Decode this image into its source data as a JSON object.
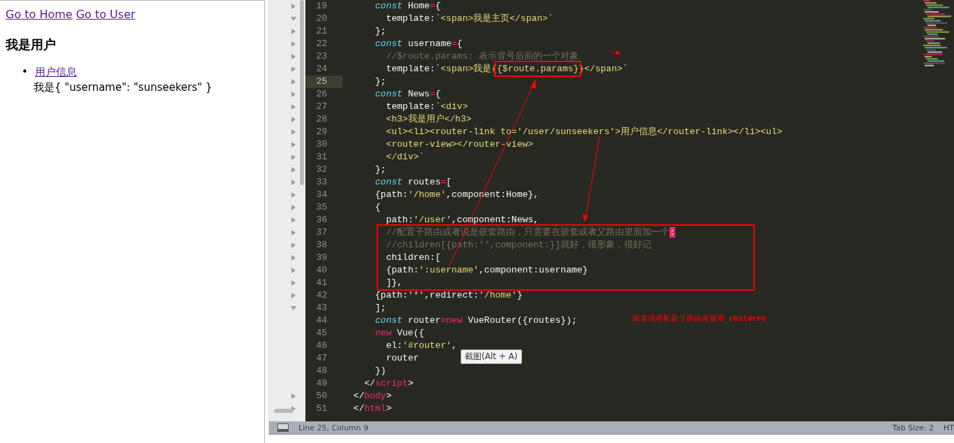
{
  "browser": {
    "links": [
      "Go to Home",
      "Go to User"
    ],
    "heading": "我是用户",
    "list": [
      {
        "marker": "•",
        "link": "用户信息"
      }
    ],
    "output": "我是{ \"username\": \"sunseekers\" }"
  },
  "editor": {
    "lines": [
      {
        "n": "19",
        "current": false,
        "expanded": false,
        "tokens": [
          {
            "t": "      const",
            "kind": "keyword"
          },
          {
            "t": " Home",
            "kind": "plain"
          },
          {
            "t": "=",
            "kind": "operator"
          },
          {
            "t": "{",
            "kind": "plain"
          }
        ]
      },
      {
        "n": "20",
        "current": false,
        "expanded": true,
        "tokens": [
          {
            "t": "        template:`",
            "kind": "plain"
          },
          {
            "t": "<span>我是主页</span>",
            "kind": "string"
          },
          {
            "t": "`",
            "kind": "plain"
          }
        ]
      },
      {
        "n": "21",
        "current": false,
        "expanded": false,
        "tokens": [
          {
            "t": "      };",
            "kind": "plain"
          }
        ]
      },
      {
        "n": "22",
        "current": false,
        "expanded": false,
        "tokens": [
          {
            "t": "      const",
            "kind": "keyword"
          },
          {
            "t": " username",
            "kind": "plain"
          },
          {
            "t": "=",
            "kind": "operator"
          },
          {
            "t": "{",
            "kind": "plain"
          }
        ]
      },
      {
        "n": "23",
        "current": false,
        "expanded": false,
        "tokens": [
          {
            "t": "        //$route.params: 表示冒号后面的一个对象",
            "kind": "comment"
          }
        ]
      },
      {
        "n": "24",
        "current": false,
        "expanded": false,
        "tokens": [
          {
            "t": "        template:`",
            "kind": "plain"
          },
          {
            "t": "<span>我是{",
            "kind": "string"
          },
          {
            "t": "{$route.params}",
            "kind": "string",
            "boxed": true
          },
          {
            "t": "}</span>",
            "kind": "string"
          },
          {
            "t": "`",
            "kind": "plain"
          }
        ]
      },
      {
        "n": "25",
        "current": true,
        "expanded": false,
        "tokens": [
          {
            "t": "      };",
            "kind": "plain"
          }
        ]
      },
      {
        "n": "26",
        "current": false,
        "expanded": false,
        "tokens": [
          {
            "t": "      const",
            "kind": "keyword"
          },
          {
            "t": " News",
            "kind": "plain"
          },
          {
            "t": "=",
            "kind": "operator"
          },
          {
            "t": "{",
            "kind": "plain"
          }
        ]
      },
      {
        "n": "27",
        "current": false,
        "expanded": false,
        "tokens": [
          {
            "t": "        template:`",
            "kind": "plain"
          },
          {
            "t": "<div>",
            "kind": "string"
          }
        ]
      },
      {
        "n": "28",
        "current": false,
        "expanded": false,
        "tokens": [
          {
            "t": "        <h3>我是用户</h3>",
            "kind": "string"
          }
        ]
      },
      {
        "n": "29",
        "current": false,
        "expanded": false,
        "tokens": [
          {
            "t": "        <ul><li><router-link to='/user/sunseekers'>用户信息</router-link></li><ul>",
            "kind": "string"
          }
        ]
      },
      {
        "n": "30",
        "current": false,
        "expanded": false,
        "tokens": [
          {
            "t": "        <router-view></router-view>",
            "kind": "string"
          }
        ]
      },
      {
        "n": "31",
        "current": false,
        "expanded": false,
        "tokens": [
          {
            "t": "        </div>",
            "kind": "string"
          },
          {
            "t": "`",
            "kind": "plain"
          }
        ]
      },
      {
        "n": "32",
        "current": false,
        "expanded": false,
        "tokens": [
          {
            "t": "      };",
            "kind": "plain"
          }
        ]
      },
      {
        "n": "33",
        "current": false,
        "expanded": false,
        "tokens": [
          {
            "t": "      const",
            "kind": "keyword"
          },
          {
            "t": " routes",
            "kind": "plain"
          },
          {
            "t": "=",
            "kind": "operator"
          },
          {
            "t": "[",
            "kind": "plain"
          }
        ]
      },
      {
        "n": "34",
        "current": false,
        "expanded": false,
        "tokens": [
          {
            "t": "      {path:",
            "kind": "plain"
          },
          {
            "t": "'/home'",
            "kind": "string"
          },
          {
            "t": ",component:Home},",
            "kind": "plain"
          }
        ]
      },
      {
        "n": "35",
        "current": false,
        "expanded": false,
        "tokens": [
          {
            "t": "      {",
            "kind": "plain"
          }
        ]
      },
      {
        "n": "36",
        "current": false,
        "expanded": false,
        "tokens": [
          {
            "t": "        path:",
            "kind": "plain"
          },
          {
            "t": "'/user'",
            "kind": "string"
          },
          {
            "t": ",component:News,",
            "kind": "plain"
          }
        ]
      },
      {
        "n": "37",
        "current": false,
        "expanded": false,
        "tokens": [
          {
            "t": "        //配置子路由或者说是嵌套路由，只需要在嵌套或者父路由里面加一个",
            "kind": "comment"
          },
          {
            "t": ":",
            "kind": "cursor"
          }
        ]
      },
      {
        "n": "38",
        "current": false,
        "expanded": false,
        "tokens": [
          {
            "t": "        //children[{path:'',component:}]就好，很形象，很好记",
            "kind": "comment"
          }
        ]
      },
      {
        "n": "39",
        "current": false,
        "expanded": false,
        "tokens": [
          {
            "t": "        children:[",
            "kind": "plain"
          }
        ]
      },
      {
        "n": "40",
        "current": false,
        "expanded": false,
        "tokens": [
          {
            "t": "        {path:",
            "kind": "plain"
          },
          {
            "t": "':username'",
            "kind": "string"
          },
          {
            "t": ",component:username}",
            "kind": "plain"
          }
        ]
      },
      {
        "n": "41",
        "current": false,
        "expanded": false,
        "tokens": [
          {
            "t": "        ]},",
            "kind": "plain"
          }
        ]
      },
      {
        "n": "42",
        "current": false,
        "expanded": false,
        "tokens": [
          {
            "t": "      {path:",
            "kind": "plain"
          },
          {
            "t": "'*'",
            "kind": "string"
          },
          {
            "t": ",redirect:",
            "kind": "plain"
          },
          {
            "t": "'/home'",
            "kind": "string"
          },
          {
            "t": "}",
            "kind": "plain"
          }
        ]
      },
      {
        "n": "43",
        "current": false,
        "expanded": true,
        "tokens": [
          {
            "t": "      ];",
            "kind": "plain"
          }
        ]
      },
      {
        "n": "44",
        "current": false,
        "tokens": [
          {
            "t": "      const",
            "kind": "keyword"
          },
          {
            "t": " router",
            "kind": "plain"
          },
          {
            "t": "=new",
            "kind": "operator"
          },
          {
            "t": " VueRouter({routes});",
            "kind": "plain"
          }
        ]
      },
      {
        "n": "45",
        "current": false,
        "tokens": [
          {
            "t": "      new",
            "kind": "operator"
          },
          {
            "t": " Vue({",
            "kind": "plain"
          }
        ]
      },
      {
        "n": "46",
        "current": false,
        "tokens": [
          {
            "t": "        el:",
            "kind": "plain"
          },
          {
            "t": "'#router'",
            "kind": "string"
          },
          {
            "t": ",",
            "kind": "plain"
          }
        ]
      },
      {
        "n": "47",
        "current": false,
        "tokens": [
          {
            "t": "        router",
            "kind": "plain"
          }
        ]
      },
      {
        "n": "48",
        "current": false,
        "tokens": [
          {
            "t": "      })",
            "kind": "plain"
          }
        ]
      },
      {
        "n": "49",
        "current": false,
        "tokens": [
          {
            "t": "    </",
            "kind": "plain"
          },
          {
            "t": "script",
            "kind": "tag"
          },
          {
            "t": ">",
            "kind": "plain"
          }
        ]
      },
      {
        "n": "50",
        "current": false,
        "expanded": false,
        "tokens": [
          {
            "t": "  </",
            "kind": "plain"
          },
          {
            "t": "body",
            "kind": "tag"
          },
          {
            "t": ">",
            "kind": "plain"
          }
        ]
      },
      {
        "n": "51",
        "current": false,
        "expanded": false,
        "tokens": [
          {
            "t": "  </",
            "kind": "plain"
          },
          {
            "t": "html",
            "kind": "tag"
          },
          {
            "t": ">",
            "kind": "plain"
          }
        ]
      }
    ],
    "note": {
      "text": "嵌套或者配套子路由直接用",
      "code": "children"
    },
    "tooltip": "截图(Alt + A)",
    "status_bar": {
      "position": "Line 25, Column 9",
      "tab_size": "Tab Size: 2",
      "syntax": "HT"
    }
  }
}
